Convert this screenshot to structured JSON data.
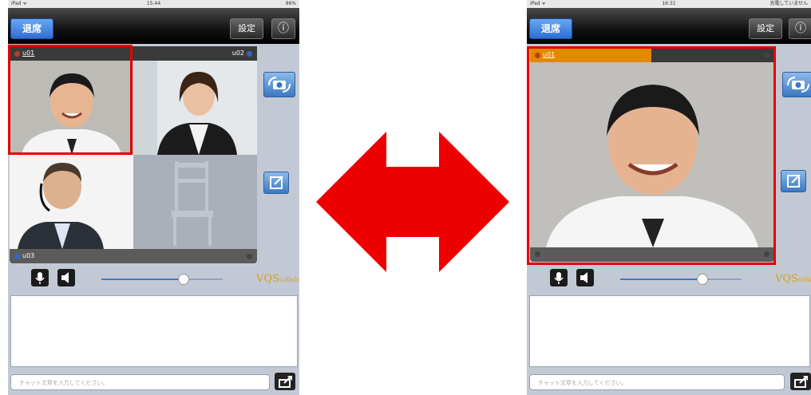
{
  "left_screen": {
    "status": {
      "carrier": "iPad ᯤ",
      "time": "15:44",
      "battery": "96%"
    },
    "nav": {
      "leave_label": "退席",
      "settings_label": "設定",
      "info_label": "ⓘ"
    },
    "tiles": [
      {
        "user": "u01",
        "dot_color": "#c0392b"
      },
      {
        "user": "u02",
        "dot_color": "#2b68c7"
      },
      {
        "user": "u03",
        "dot_color": "#2b68c7"
      }
    ],
    "volume_level": 0.68,
    "brand": {
      "main": "VQS",
      "sub": "collabo"
    },
    "chat_placeholder": "チャット文章を入力してください。"
  },
  "right_screen": {
    "status": {
      "carrier": "iPad ᯤ",
      "time": "16:31",
      "battery": "充電していません"
    },
    "nav": {
      "leave_label": "退席",
      "settings_label": "設定",
      "info_label": "ⓘ"
    },
    "tiles": [
      {
        "user": "u01",
        "dot_color": "#c0392b"
      }
    ],
    "volume_level": 0.68,
    "brand": {
      "main": "VQS",
      "sub": "collab"
    },
    "chat_placeholder": "チャット文章を入力してください。"
  },
  "colors": {
    "highlight": "#e60000",
    "accent": "#2c6fd4",
    "talking_bar": "#e08a00"
  }
}
